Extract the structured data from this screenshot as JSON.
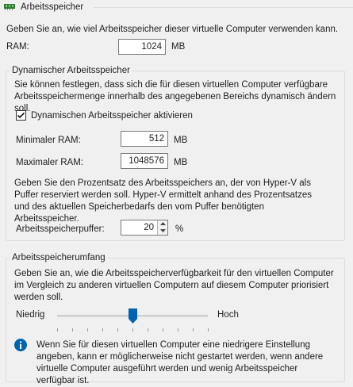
{
  "header": {
    "title": "Arbeitsspeicher"
  },
  "intro": "Geben Sie an, wie viel Arbeitsspeicher dieser virtuelle Computer verwenden kann.",
  "ram": {
    "label": "RAM:",
    "value": "1024",
    "unit": "MB"
  },
  "dynamic": {
    "legend": "Dynamischer Arbeitsspeicher",
    "description": "Sie können festlegen, dass sich die für diesen virtuellen Computer verfügbare Arbeitsspeichermenge innerhalb des angegebenen Bereichs dynamisch ändern soll.",
    "checkbox_label": "Dynamischen Arbeitsspeicher aktivieren",
    "checked": true,
    "min_label": "Minimaler RAM:",
    "min_value": "512",
    "min_unit": "MB",
    "max_label": "Maximaler RAM:",
    "max_value": "1048576",
    "max_unit": "MB",
    "buffer_description": "Geben Sie den Prozentsatz des Arbeitsspeichers an, der von Hyper-V als Puffer reserviert werden soll. Hyper-V ermittelt anhand des Prozentsatzes und des aktuellen Speicherbedarfs den vom Puffer benötigten Arbeitsspeicher.",
    "buffer_label": "Arbeitsspeicherpuffer:",
    "buffer_value": "20",
    "buffer_unit": "%"
  },
  "weight": {
    "legend": "Arbeitsspeicherumfang",
    "description": "Geben Sie an, wie die Arbeitsspeicherverfügbarkeit für den virtuellen Computer im Vergleich zu anderen virtuellen Computern auf diesem Computer priorisiert werden soll.",
    "low_label": "Niedrig",
    "high_label": "Hoch",
    "slider_level": 0.5,
    "info_text": "Wenn Sie für diesen virtuellen Computer eine niedrigere Einstellung angeben, kann er möglicherweise nicht gestartet werden, wenn andere virtuelle Computer ausgeführt werden und wenig Arbeitsspeicher verfügbar ist."
  },
  "icons": {
    "header": "memory-chip-icon",
    "check": "checkmark-icon",
    "spin_up": "spin-up-icon",
    "spin_down": "spin-down-icon",
    "slider": "slider-thumb-icon",
    "info": "info-icon"
  },
  "colors": {
    "chip": "#2e7d32",
    "slider_thumb": "#0063b1",
    "info": "#0063b1"
  }
}
